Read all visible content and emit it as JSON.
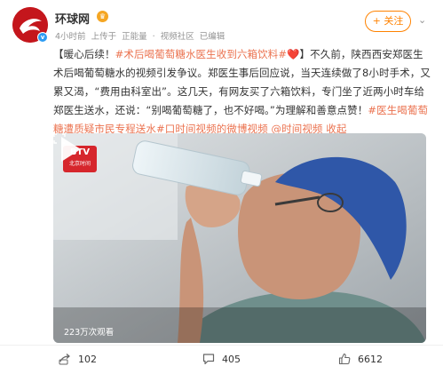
{
  "post": {
    "username": "环球网",
    "crown_glyph": "♛",
    "meta": {
      "time": "4小时前",
      "via": "上传于",
      "source": "正能量",
      "sep": "·",
      "channel": "视频社区",
      "edited": "已编辑"
    },
    "follow_label": "+ 关注",
    "text": {
      "p1": "【暖心后续！",
      "h1": "#术后喝葡萄糖水医生收到六箱饮料#",
      "heart": "❤️",
      "p2": "】不久前，陕西西安郑医生术后喝葡萄糖水的视频引发争议。郑医生事后回应说，当天连续做了8小时手术，又累又渴，“费用由科室出”。这几天，有网友买了六箱饮料，专门坐了近两小时车给郑医生送水，还说：“别喝葡萄糖了，也不好喝。”为理解和善意点赞！",
      "h2": "#医生喝葡萄糖遭质疑市民专程送水#",
      "video_link": "口时间视频的微博视频",
      "author_link": "@时间视频",
      "collapse": "收起"
    }
  },
  "video": {
    "logo_line1": "BTV",
    "logo_line2": "北京时间",
    "views": "223万次观看"
  },
  "actions": {
    "repost": "102",
    "comment": "405",
    "like": "6612"
  },
  "colors": {
    "brand_red": "#c4161c",
    "accent_orange": "#ff8200",
    "link_orange": "#eb7350"
  }
}
